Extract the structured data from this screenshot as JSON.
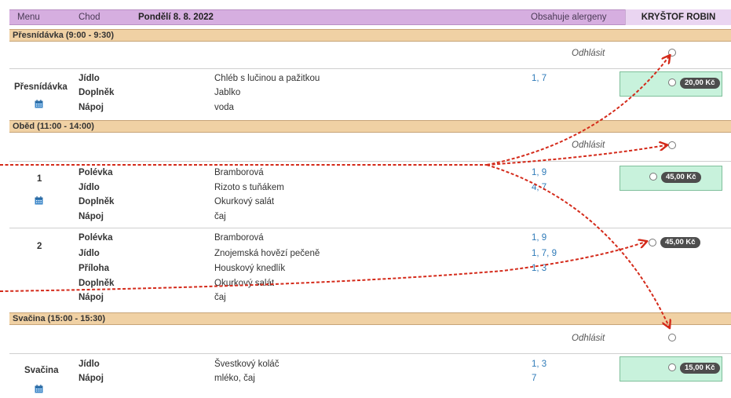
{
  "header": {
    "menu": "Menu",
    "chod": "Chod",
    "date": "Pondělí 8. 8. 2022",
    "allergens": "Obsahuje alergeny",
    "user": "KRYŠTOF ROBIN"
  },
  "colors": {
    "header": "#d6aee0",
    "section": "#f0d1a4",
    "order_box": "#c8f2dc",
    "arrow": "#d42a1a",
    "link": "#2e7ab8"
  },
  "cancel_label": "Odhlásit",
  "sections": [
    {
      "title": "Přesnídávka (9:00 - 9:30)",
      "meals": [
        {
          "name": "Přesnídávka",
          "price": "20,00 Kč",
          "rows": [
            {
              "label": "Jídlo",
              "value": "Chléb s lučinou a pažitkou",
              "allergens": "1, 7"
            },
            {
              "label": "Doplněk",
              "value": "Jablko",
              "allergens": ""
            },
            {
              "label": "Nápoj",
              "value": "voda",
              "allergens": ""
            }
          ]
        }
      ]
    },
    {
      "title": "Oběd (11:00 - 14:00)",
      "meals": [
        {
          "name": "1",
          "price": "45,00 Kč",
          "rows": [
            {
              "label": "Polévka",
              "value": "Bramborová",
              "allergens": "1, 9"
            },
            {
              "label": "Jídlo",
              "value": "Rizoto s tuňákem",
              "allergens": "4, 7"
            },
            {
              "label": "Doplněk",
              "value": "Okurkový salát",
              "allergens": ""
            },
            {
              "label": "Nápoj",
              "value": "čaj",
              "allergens": ""
            }
          ]
        },
        {
          "name": "2",
          "price": "45,00 Kč",
          "rows": [
            {
              "label": "Polévka",
              "value": "Bramborová",
              "allergens": "1, 9"
            },
            {
              "label": "Jídlo",
              "value": "Znojemská hovězí pečeně",
              "allergens": "1, 7, 9"
            },
            {
              "label": "Příloha",
              "value": "Houskový knedlík",
              "allergens": "1, 3"
            },
            {
              "label": "Doplněk",
              "value": "Okurkový salát",
              "allergens": ""
            },
            {
              "label": "Nápoj",
              "value": "čaj",
              "allergens": ""
            }
          ]
        }
      ]
    },
    {
      "title": "Svačina (15:00 - 15:30)",
      "meals": [
        {
          "name": "Svačina",
          "price": "15,00 Kč",
          "rows": [
            {
              "label": "Jídlo",
              "value": "Švestkový koláč",
              "allergens": "1, 3"
            },
            {
              "label": "Nápoj",
              "value": "mléko, čaj",
              "allergens": "7"
            }
          ]
        }
      ]
    }
  ]
}
